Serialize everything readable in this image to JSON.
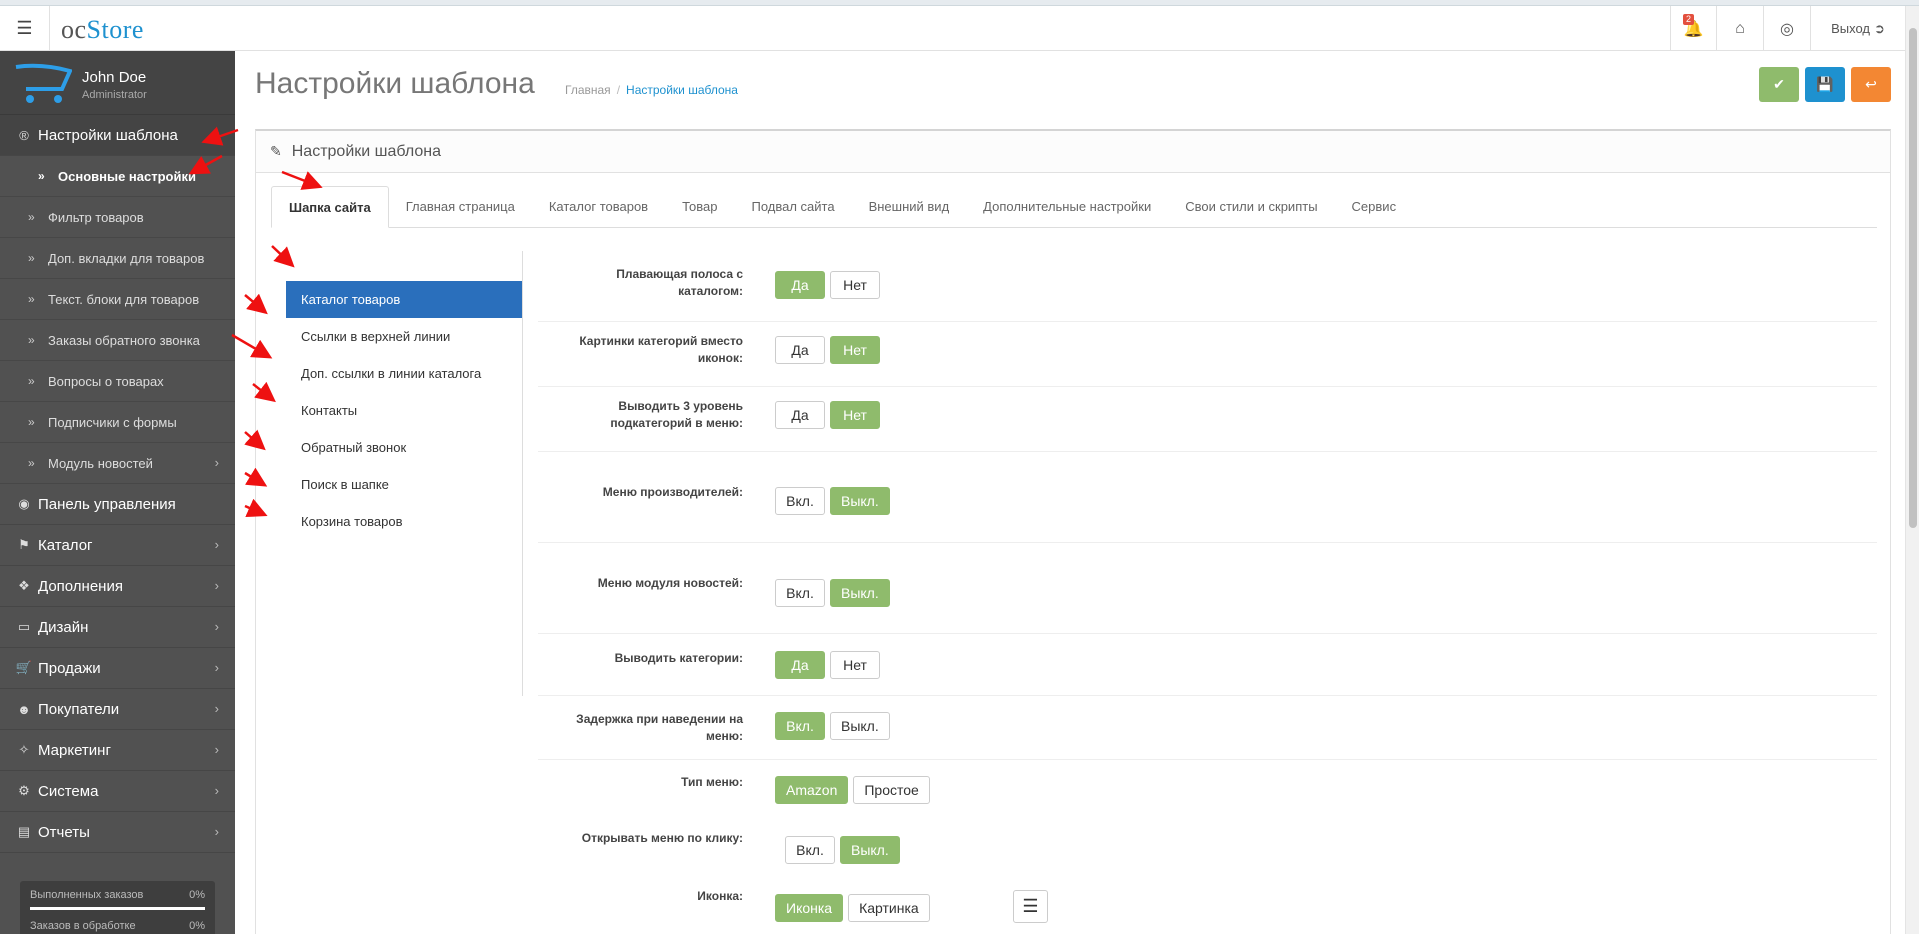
{
  "header": {
    "logo_prefix": "oc",
    "logo_suffix": "Store",
    "notifications_count": "2",
    "logout_label": "Выход"
  },
  "profile": {
    "name": "John Doe",
    "role": "Administrator"
  },
  "sidebar": {
    "items": [
      {
        "label": "Настройки шаблона",
        "icon": "registered-icon"
      },
      {
        "label": "Основные настройки"
      },
      {
        "label": "Фильтр товаров"
      },
      {
        "label": "Доп. вкладки для товаров"
      },
      {
        "label": "Текст. блоки для товаров"
      },
      {
        "label": "Заказы обратного звонка"
      },
      {
        "label": "Вопросы о товарах"
      },
      {
        "label": "Подписчики с формы"
      },
      {
        "label": "Модуль новостей"
      },
      {
        "label": "Панель управления",
        "icon": "dashboard-icon"
      },
      {
        "label": "Каталог",
        "icon": "tags-icon"
      },
      {
        "label": "Дополнения",
        "icon": "puzzle-icon"
      },
      {
        "label": "Дизайн",
        "icon": "monitor-icon"
      },
      {
        "label": "Продажи",
        "icon": "cart-icon"
      },
      {
        "label": "Покупатели",
        "icon": "user-icon"
      },
      {
        "label": "Маркетинг",
        "icon": "share-icon"
      },
      {
        "label": "Система",
        "icon": "gear-icon"
      },
      {
        "label": "Отчеты",
        "icon": "bar-chart-icon"
      }
    ],
    "stats": [
      {
        "label": "Выполненных заказов",
        "value": "0%"
      },
      {
        "label": "Заказов в обработке",
        "value": "0%"
      }
    ]
  },
  "page": {
    "title": "Настройки шаблона",
    "breadcrumb": [
      "Главная",
      "Настройки шаблона"
    ],
    "colors": {
      "save_green": "#8fbb6c",
      "save_blue": "#1e91cf",
      "back_orange": "#f38733"
    }
  },
  "panel": {
    "heading": "Настройки шаблона",
    "tabs": [
      "Шапка сайта",
      "Главная страница",
      "Каталог товаров",
      "Товар",
      "Подвал сайта",
      "Внешний вид",
      "Дополнительные настройки",
      "Свои стили и скрипты",
      "Сервис"
    ],
    "vtabs": [
      "Каталог товаров",
      "Ссылки в верхней линии",
      "Доп. ссылки в линии каталога",
      "Контакты",
      "Обратный звонок",
      "Поиск в шапке",
      "Корзина товаров"
    ]
  },
  "form": {
    "rows": [
      {
        "label1": "Плавающая полоса с",
        "label2": "каталогом:",
        "opt1": "Да",
        "opt2": "Нет",
        "selected": 1
      },
      {
        "label1": "Картинки категорий вместо",
        "label2": "иконок:",
        "opt1": "Да",
        "opt2": "Нет",
        "selected": 2
      },
      {
        "label1": "Выводить 3 уровень",
        "label2": "подкатегорий в меню:",
        "opt1": "Да",
        "opt2": "Нет",
        "selected": 2
      },
      {
        "label1": "Меню производителей:",
        "label2": "",
        "opt1": "Вкл.",
        "opt2": "Выкл.",
        "selected": 2
      },
      {
        "label1": "Меню модуля новостей:",
        "label2": "",
        "opt1": "Вкл.",
        "opt2": "Выкл.",
        "selected": 2
      },
      {
        "label1": "Выводить категории:",
        "label2": "",
        "opt1": "Да",
        "opt2": "Нет",
        "selected": 1
      },
      {
        "label1": "Задержка при наведении на",
        "label2": "меню:",
        "opt1": "Вкл.",
        "opt2": "Выкл.",
        "selected": 1
      },
      {
        "label1": "Тип меню:",
        "label2": "",
        "opt1": "Amazon",
        "opt2": "Простое",
        "selected": 1
      },
      {
        "label1": "Открывать меню по клику:",
        "label2": "",
        "opt1": "Вкл.",
        "opt2": "Выкл.",
        "selected": 2
      },
      {
        "label1": "Иконка:",
        "label2": "",
        "opt1": "Иконка",
        "opt2": "Картинка",
        "selected": 1
      }
    ]
  }
}
